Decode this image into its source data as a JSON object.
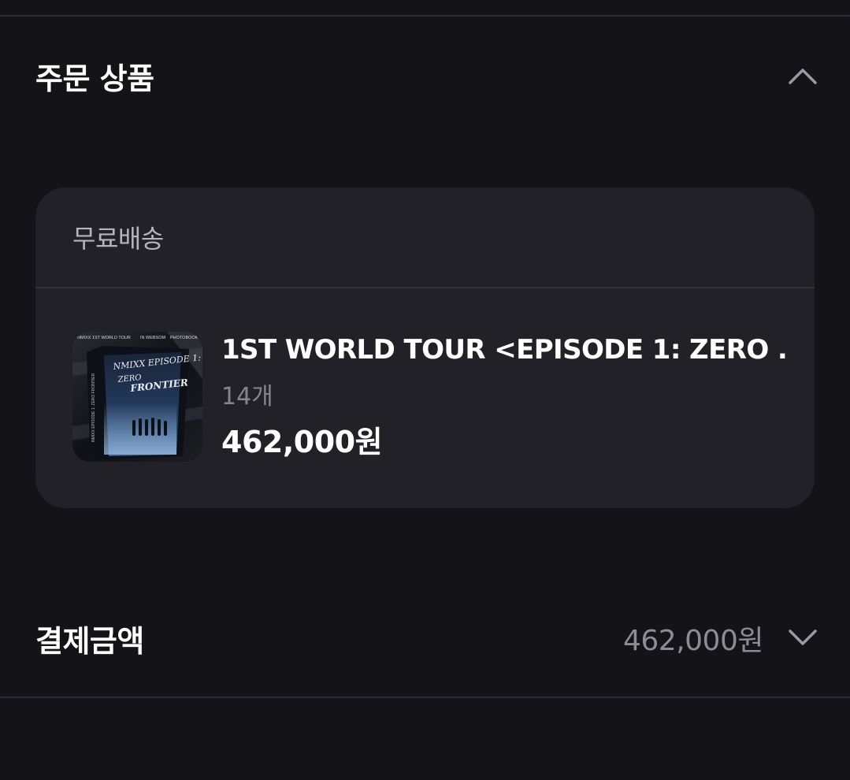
{
  "order_items_section": {
    "title": "주문 상품",
    "toggle_icon": "chevron-up-icon"
  },
  "order_card": {
    "shipping_label": "무료배송",
    "product": {
      "name": "1ST WORLD TOUR <EPISODE 1: ZERO ...",
      "quantity": "14개",
      "price": "462,000원",
      "thumbnail": {
        "header_texts": [
          "NMIXX 1ST WORLD TOUR",
          "IN WEBSOM",
          "PHOTOBOOK"
        ],
        "cover_text": "NMIXX EPISODE 1: ZERO FRONTIER"
      }
    }
  },
  "payment_section": {
    "title": "결제금액",
    "amount": "462,000원",
    "toggle_icon": "chevron-down-icon"
  },
  "colors": {
    "background": "#141318",
    "card": "#222127",
    "text_primary": "#ffffff",
    "text_secondary": "#86858c"
  }
}
